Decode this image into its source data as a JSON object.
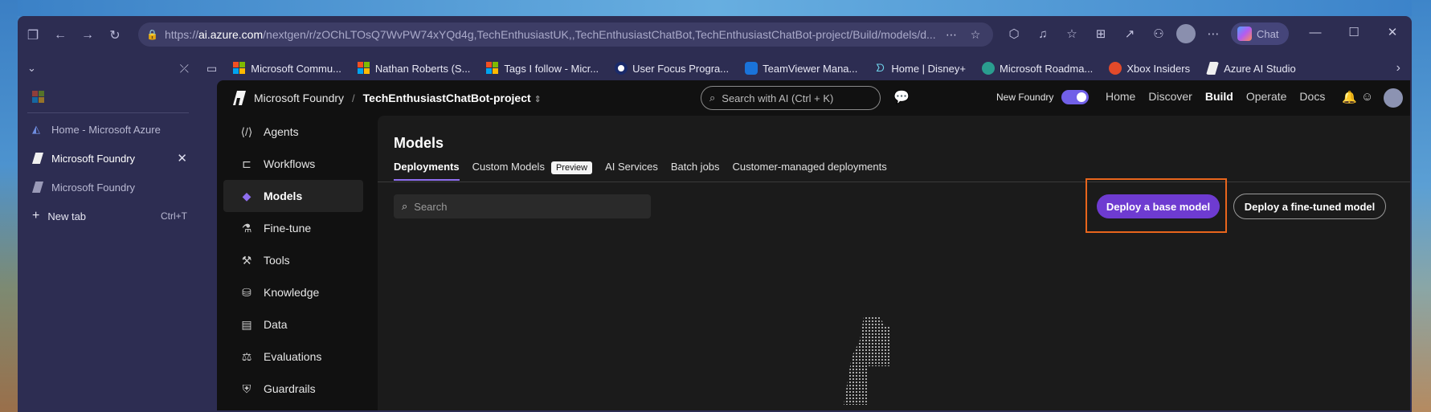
{
  "browser": {
    "url_prefix": "https://",
    "url_domain": "ai.azure.com",
    "url_rest": "/nextgen/r/zOChLTOsQ7WvPW74xYQd4g,TechEnthusiastUK,,TechEnthusiastChatBot,TechEnthusiastChatBot-project/Build/models/d...",
    "chat_label": "Chat"
  },
  "favorites": [
    {
      "label": "Microsoft Commu...",
      "icon": "microsoft-logo"
    },
    {
      "label": "Nathan Roberts (S...",
      "icon": "microsoft-logo"
    },
    {
      "label": "Tags I follow - Micr...",
      "icon": "microsoft-logo"
    },
    {
      "label": "User Focus Progra...",
      "icon": "user-focus-icon"
    },
    {
      "label": "TeamViewer Mana...",
      "icon": "teamviewer-icon"
    },
    {
      "label": "Home | Disney+",
      "icon": "disney-icon"
    },
    {
      "label": "Microsoft Roadma...",
      "icon": "roadmap-icon"
    },
    {
      "label": "Xbox Insiders",
      "icon": "xbox-insiders-icon"
    },
    {
      "label": "Azure AI Studio",
      "icon": "azure-ai-icon"
    }
  ],
  "vertical_tabs": [
    {
      "label": "Home - Microsoft Azure"
    },
    {
      "label": "Microsoft Foundry"
    },
    {
      "label": "Microsoft Foundry"
    }
  ],
  "new_tab": {
    "label": "New tab",
    "shortcut": "Ctrl+T"
  },
  "header": {
    "brand": "Microsoft Foundry",
    "separator": "/",
    "project": "TechEnthusiastChatBot-project",
    "search_placeholder": "Search with AI (Ctrl + K)",
    "new_foundry_label": "New Foundry",
    "nav": [
      "Home",
      "Discover",
      "Build",
      "Operate",
      "Docs"
    ],
    "active_nav": "Build"
  },
  "leftnav": [
    {
      "label": "Agents",
      "icon": "agents-icon"
    },
    {
      "label": "Workflows",
      "icon": "workflows-icon"
    },
    {
      "label": "Models",
      "icon": "models-icon"
    },
    {
      "label": "Fine-tune",
      "icon": "flask-icon"
    },
    {
      "label": "Tools",
      "icon": "tools-icon"
    },
    {
      "label": "Knowledge",
      "icon": "knowledge-icon"
    },
    {
      "label": "Data",
      "icon": "data-icon"
    },
    {
      "label": "Evaluations",
      "icon": "scale-icon"
    },
    {
      "label": "Guardrails",
      "icon": "shield-icon"
    }
  ],
  "main": {
    "title": "Models",
    "tabs": [
      "Deployments",
      "Custom Models",
      "AI Services",
      "Batch jobs",
      "Customer-managed deployments"
    ],
    "preview_badge": "Preview",
    "search_placeholder": "Search",
    "deploy_base": "Deploy a base model",
    "deploy_finetuned": "Deploy a fine-tuned model"
  },
  "colors": {
    "accent": "#6e3bd1",
    "highlight": "#e8651c",
    "toggle": "#7160e8"
  }
}
